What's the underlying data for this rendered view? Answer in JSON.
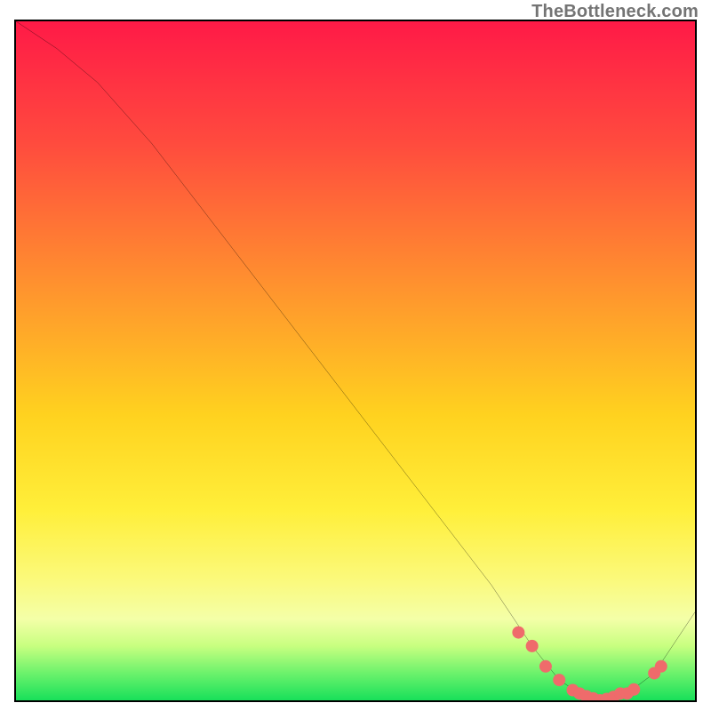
{
  "watermark": "TheBottleneck.com",
  "chart_data": {
    "type": "line",
    "title": "",
    "xlabel": "",
    "ylabel": "",
    "xlim": [
      0,
      100
    ],
    "ylim": [
      0,
      100
    ],
    "grid": false,
    "series": [
      {
        "name": "bottleneck-curve",
        "x": [
          0,
          6,
          12,
          20,
          30,
          40,
          50,
          60,
          70,
          76,
          80,
          83,
          86,
          90,
          94,
          100
        ],
        "values": [
          100,
          96,
          91,
          82,
          69,
          56,
          43,
          30,
          17,
          8,
          3,
          1,
          0,
          1,
          4,
          13
        ]
      }
    ],
    "markers": {
      "name": "highlight-dots",
      "color": "#ef6b6b",
      "radius_px": 7,
      "x": [
        74,
        76,
        78,
        80,
        82,
        83,
        84,
        85,
        86,
        87,
        88,
        89,
        90,
        91,
        94,
        95
      ],
      "values": [
        10,
        8,
        5,
        3,
        1.5,
        1,
        0.6,
        0.3,
        0,
        0.2,
        0.5,
        1,
        1,
        1.6,
        4,
        5
      ]
    },
    "background_gradient": {
      "direction": "vertical",
      "stops": [
        {
          "pos": 0.0,
          "color": "#ff1a47"
        },
        {
          "pos": 0.38,
          "color": "#ff8f2f"
        },
        {
          "pos": 0.72,
          "color": "#ffef3a"
        },
        {
          "pos": 0.92,
          "color": "#c8ff80"
        },
        {
          "pos": 1.0,
          "color": "#18e05a"
        }
      ]
    }
  }
}
